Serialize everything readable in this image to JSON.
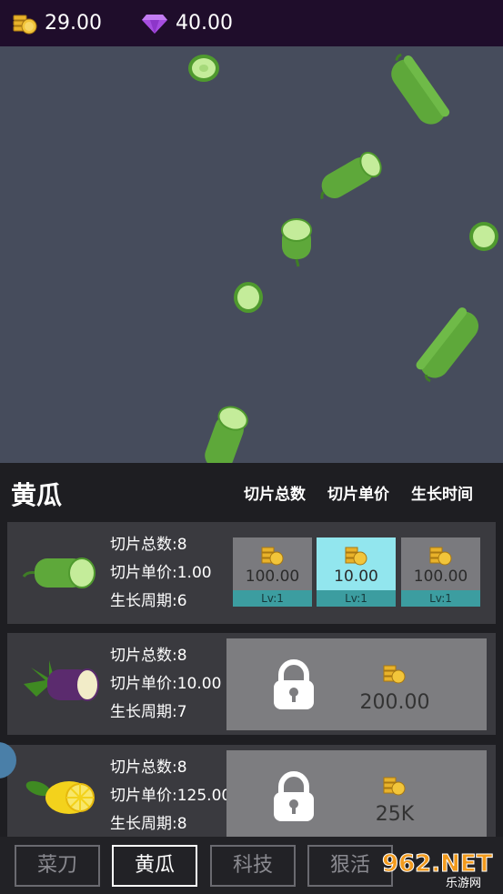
{
  "resources": {
    "gold": "29.00",
    "gems": "40.00"
  },
  "panel": {
    "title": "黄瓜",
    "headers": [
      "切片总数",
      "切片单价",
      "生长时间"
    ]
  },
  "cards": [
    {
      "veg": "cucumber-icon",
      "stats": [
        "切片总数:8",
        "切片单价:1.00",
        "生长周期:6"
      ],
      "upgrades": [
        {
          "price": "100.00",
          "lv": "Lv:1"
        },
        {
          "price": "10.00",
          "lv": "Lv:1"
        },
        {
          "price": "100.00",
          "lv": "Lv:1"
        }
      ]
    },
    {
      "veg": "eggplant-icon",
      "stats": [
        "切片总数:8",
        "切片单价:10.00",
        "生长周期:7"
      ],
      "unlock_price": "200.00"
    },
    {
      "veg": "lemon-icon",
      "stats": [
        "切片总数:8",
        "切片单价:125.00",
        "生长周期:8"
      ],
      "unlock_price": "25K"
    }
  ],
  "tabs": [
    "菜刀",
    "黄瓜",
    "科技",
    "狠活"
  ],
  "active_tab": "黄瓜",
  "watermark": {
    "text": "962.NET",
    "sub": "乐游网"
  },
  "colors": {
    "topbar": "#1f0d2b",
    "field": "#464c5c",
    "highlight": "#92e6ee",
    "level_bar": "#3c9da0"
  }
}
